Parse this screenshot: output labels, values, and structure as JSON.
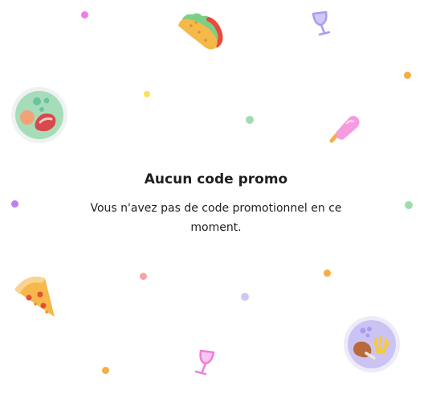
{
  "empty_state": {
    "title": "Aucun code promo",
    "message": "Vous n'avez pas de code promotionnel en ce moment."
  },
  "illustrations": [
    "taco-icon",
    "wine-glass-icon",
    "salad-plate-icon",
    "popsicle-icon",
    "pizza-slice-icon",
    "chicken-fries-plate-icon"
  ],
  "colors": {
    "text": "#1f1f1f",
    "pink": "#f27be8",
    "yellow": "#f8e35c",
    "green": "#9fdcae",
    "orange": "#f6ad45",
    "violet": "#c07ef2",
    "salmon": "#f7a3a6",
    "lavender": "#cfc7f5"
  }
}
